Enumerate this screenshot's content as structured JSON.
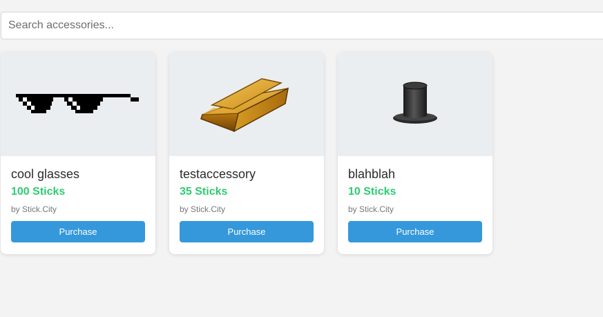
{
  "search": {
    "placeholder": "Search accessories..."
  },
  "items": [
    {
      "name": "cool glasses",
      "price": "100 Sticks",
      "creator": "by Stick.City",
      "button": "Purchase",
      "icon": "pixel-sunglasses-icon"
    },
    {
      "name": "testaccessory",
      "price": "35 Sticks",
      "creator": "by Stick.City",
      "button": "Purchase",
      "icon": "gold-bar-icon"
    },
    {
      "name": "blahblah",
      "price": "10 Sticks",
      "creator": "by Stick.City",
      "button": "Purchase",
      "icon": "top-hat-icon"
    }
  ],
  "colors": {
    "price": "#2ecc71",
    "button": "#3498db",
    "thumb_bg": "#ebeef0"
  }
}
